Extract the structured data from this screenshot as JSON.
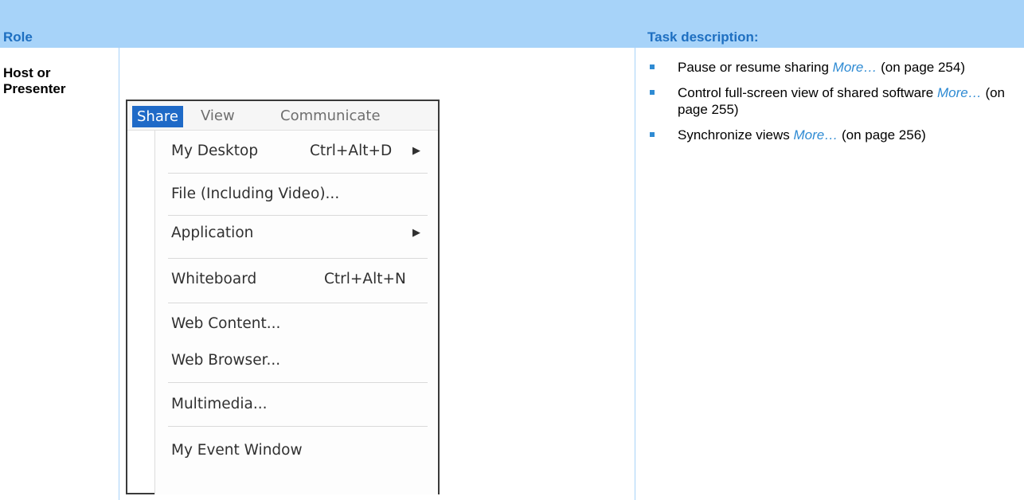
{
  "table": {
    "headers": {
      "role": "Role",
      "task": "Task description:"
    },
    "role": [
      "Host or",
      "Presenter"
    ]
  },
  "menu": {
    "bar": [
      "Share",
      "View",
      "Communicate"
    ],
    "items": [
      {
        "label": "My Desktop",
        "shortcut": "Ctrl+Alt+D",
        "submenu": true
      },
      {
        "label": "File (Including Video)..."
      },
      {
        "label": "Application",
        "submenu": true
      },
      {
        "label": "Whiteboard",
        "shortcut": "Ctrl+Alt+N"
      },
      {
        "label": "Web Content..."
      },
      {
        "label": "Web Browser..."
      },
      {
        "label": "Multimedia..."
      },
      {
        "label": "My Event Window"
      }
    ]
  },
  "tasks": [
    {
      "text": "Pause or resume sharing ",
      "link": "More…",
      "ref": " (on page 254)"
    },
    {
      "text": "Control full-screen view of shared software ",
      "link": "More…",
      "ref": " (on page 255)"
    },
    {
      "text": "Synchronize views ",
      "link": "More…",
      "ref": " (on page 256)"
    }
  ],
  "colors": {
    "header_band": "#a7d3f9",
    "header_text": "#1e6fc1",
    "link": "#2f8bd3",
    "menu_highlight": "#1f6ac7"
  }
}
